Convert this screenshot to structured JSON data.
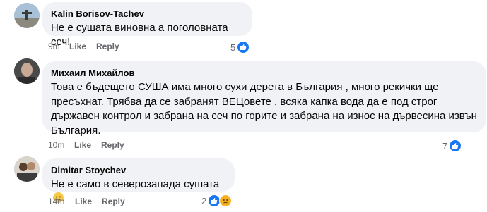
{
  "comments": [
    {
      "author": "Kalin Borisov-Tachev",
      "text": "Не е сушата виновна а поголовната сеч!",
      "time": "9m",
      "like_label": "Like",
      "reply_label": "Reply",
      "reaction_count": "5",
      "reactions": [
        "like-icon"
      ]
    },
    {
      "author": "Михаил Михайлов",
      "text": "Това е бъдещето СУША има много сухи дерета в България , много рекички ще пресъхнат. Трябва да се забранят ВЕЦовете , всяка капка вода да е под строг държавен контрол и забрана на сеч по горите и забрана на износ на дървесина извън България.",
      "time": "10m",
      "like_label": "Like",
      "reply_label": "Reply",
      "reaction_count": "7",
      "reactions": [
        "like-icon"
      ]
    },
    {
      "author": "Dimitar Stoychev",
      "text": "Не е само в северозапада сушата",
      "time": "14m",
      "like_label": "Like",
      "reply_label": "Reply",
      "reaction_count": "2",
      "reactions": [
        "like-icon",
        "sad-icon"
      ],
      "inline_emoji": "sad-face-emoji"
    }
  ],
  "colors": {
    "bubble_bg": "#f0f2f5",
    "meta_text": "#65676b",
    "like_blue": "#1877f2",
    "sad_yellow": "#f7b125"
  }
}
